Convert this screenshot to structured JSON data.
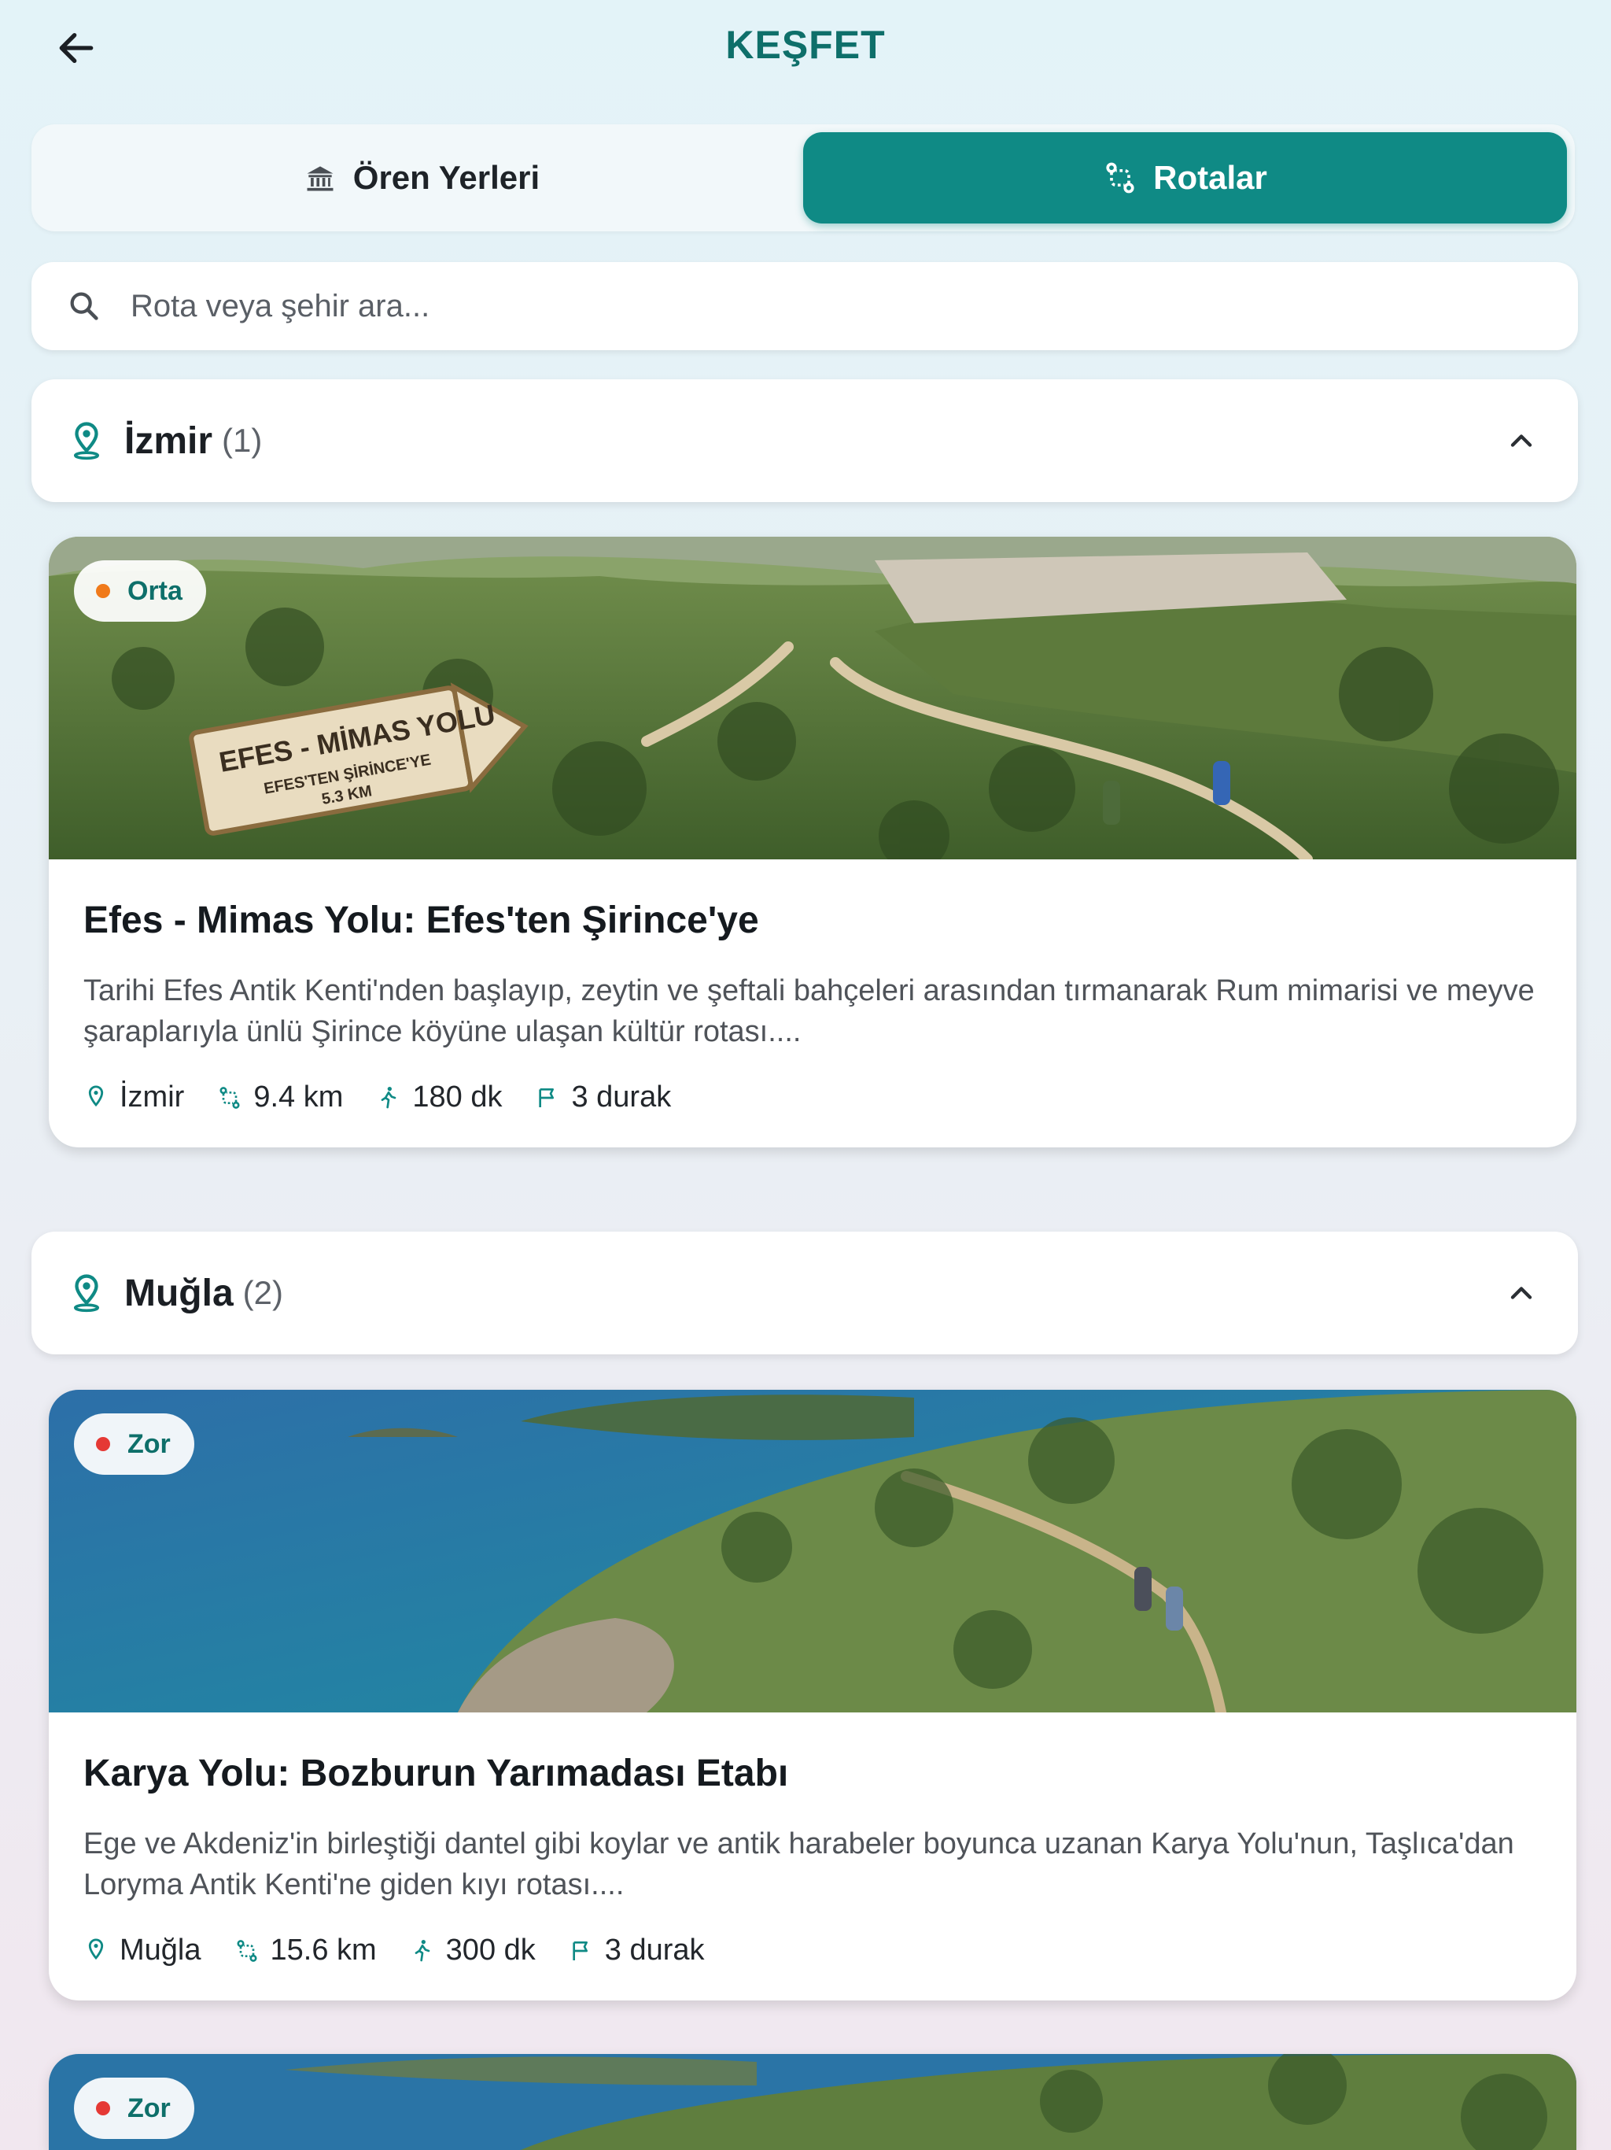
{
  "header": {
    "title": "KEŞFET"
  },
  "tabs": [
    {
      "label": "Ören Yerleri",
      "active": false,
      "icon": "museum-icon"
    },
    {
      "label": "Rotalar",
      "active": true,
      "icon": "route-icon"
    }
  ],
  "search": {
    "placeholder": "Rota veya şehir ara..."
  },
  "regions": [
    {
      "name": "İzmir",
      "count": "(1)",
      "expanded": true
    },
    {
      "name": "Muğla",
      "count": "(2)",
      "expanded": true
    }
  ],
  "routes": [
    {
      "difficulty": "Orta",
      "difficulty_color": "#f07a1a",
      "title": "Efes - Mimas Yolu: Efes'ten Şirince'ye",
      "description": "Tarihi Efes Antik Kenti'nden başlayıp, zeytin ve şeftali bahçeleri arasından tırmanarak Rum mimarisi ve meyve şaraplarıyla ünlü Şirince köyüne ulaşan kültür rotası....",
      "city": "İzmir",
      "distance": "9.4 km",
      "duration": "180 dk",
      "stops": "3 durak",
      "sign_line1": "EFES - MİMAS YOLU",
      "sign_line2": "EFES'TEN ŞİRİNCE'YE",
      "sign_line3": "5.3 KM"
    },
    {
      "difficulty": "Zor",
      "difficulty_color": "#e53935",
      "title": "Karya Yolu: Bozburun Yarımadası Etabı",
      "description": "Ege ve Akdeniz'in birleştiği dantel gibi koylar ve antik harabeler boyunca uzanan Karya Yolu'nun, Taşlıca'dan Loryma Antik Kenti'ne giden kıyı rotası....",
      "city": "Muğla",
      "distance": "15.6 km",
      "duration": "300 dk",
      "stops": "3 durak"
    },
    {
      "difficulty": "Zor",
      "difficulty_color": "#e53935"
    }
  ],
  "colors": {
    "accent": "#0f8a85",
    "title": "#0e6f6a"
  }
}
